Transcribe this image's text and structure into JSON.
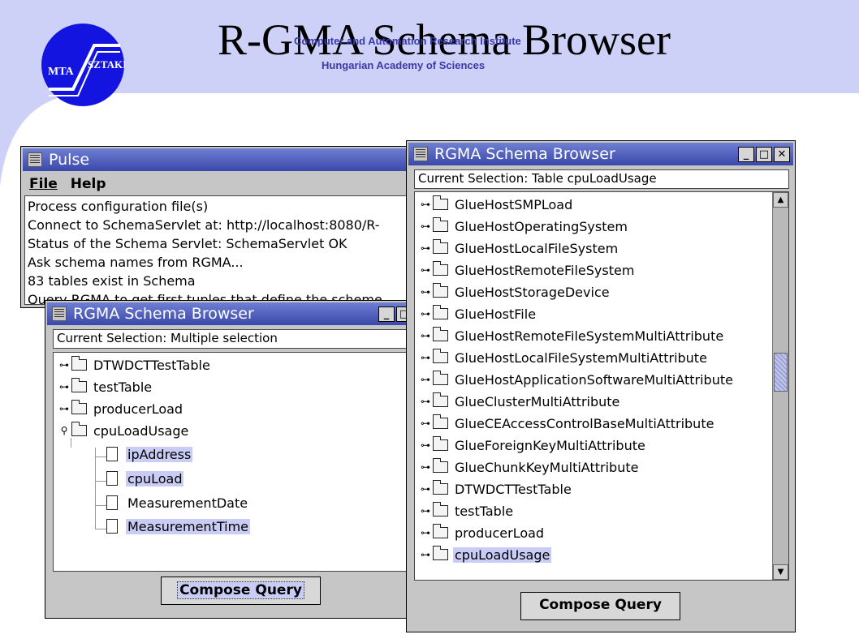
{
  "slide": {
    "title": "R-GMA Schema Browser",
    "institute_line1": "Computer and Automation Research Institute",
    "institute_line2": "Hungarian Academy of Sciences",
    "logo_left_text": "MTA",
    "logo_right_text": "SZTAKI"
  },
  "pulse_window": {
    "title": "Pulse",
    "menu": [
      "File",
      "Help"
    ],
    "log_lines": [
      "Process configuration file(s)",
      "Connect to SchemaServlet at: http://localhost:8080/R-",
      "Status of the Schema Servlet: SchemaServlet OK",
      "Ask schema names from RGMA...",
      "83 tables exist in Schema",
      "Query RGMA to get first tuples that define the scheme"
    ]
  },
  "browser_small": {
    "title": "RGMA Schema Browser",
    "current_selection": "Current Selection: Multiple selection",
    "tables": [
      "DTWDCTTestTable",
      "testTable",
      "producerLoad",
      "cpuLoadUsage"
    ],
    "columns": [
      {
        "label": "ipAddress",
        "selected": true
      },
      {
        "label": "cpuLoad",
        "selected": true
      },
      {
        "label": "MeasurementDate",
        "selected": false
      },
      {
        "label": "MeasurementTime",
        "selected": true
      }
    ],
    "button": "Compose Query"
  },
  "browser_large": {
    "title": "RGMA Schema Browser",
    "current_selection": "Current Selection: Table cpuLoadUsage",
    "items": [
      "GlueHostSMPLoad",
      "GlueHostOperatingSystem",
      "GlueHostLocalFileSystem",
      "GlueHostRemoteFileSystem",
      "GlueHostStorageDevice",
      "GlueHostFile",
      "GlueHostRemoteFileSystemMultiAttribute",
      "GlueHostLocalFileSystemMultiAttribute",
      "GlueHostApplicationSoftwareMultiAttribute",
      "GlueClusterMultiAttribute",
      "GlueCEAccessControlBaseMultiAttribute",
      "GlueForeignKeyMultiAttribute",
      "GlueChunkKeyMultiAttribute",
      "DTWDCTTestTable",
      "testTable",
      "producerLoad",
      "cpuLoadUsage"
    ],
    "selected_item": "cpuLoadUsage",
    "button": "Compose Query"
  },
  "colors": {
    "title_bar": "#3a48aa",
    "selection": "#c9cdf6",
    "background_accent": "#cdd0f7",
    "logo": "#1414e0"
  }
}
